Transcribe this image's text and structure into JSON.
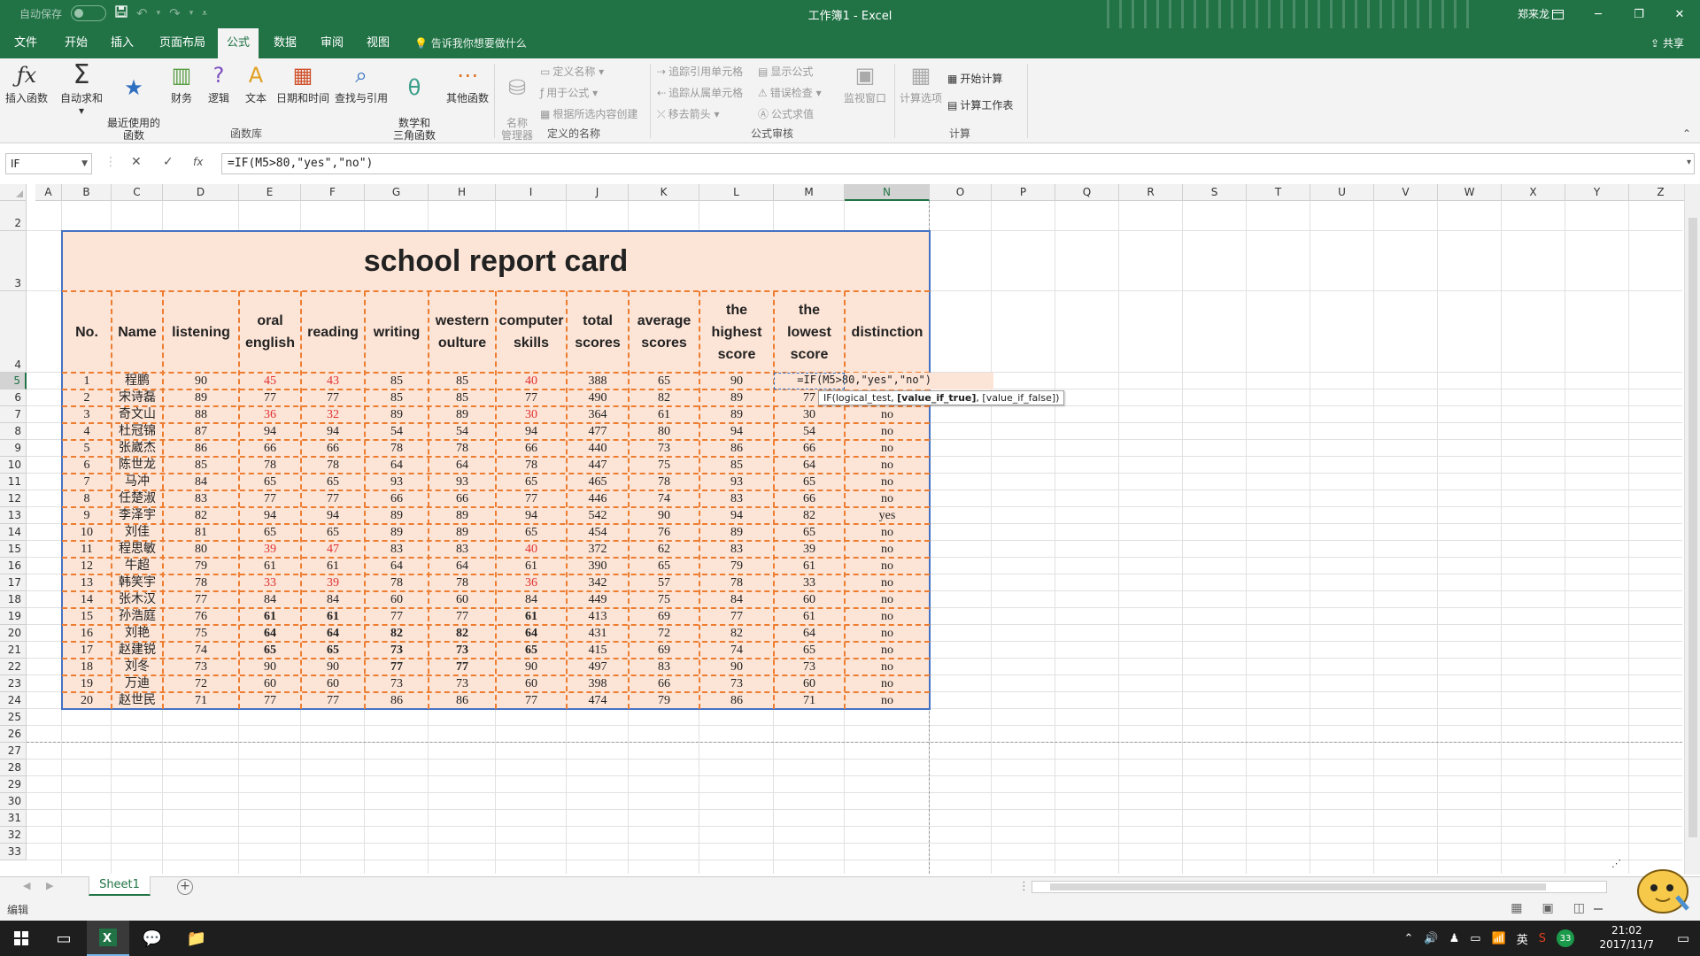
{
  "titlebar": {
    "autosave_label": "自动保存",
    "save_icon": "save-icon",
    "undo_icon": "undo-icon",
    "redo_icon": "redo-icon",
    "doc_title": "工作簿1  -  Excel",
    "user_name": "郑来龙",
    "restore_icon": "ribbon-display-icon",
    "minimize": "─",
    "maximize": "❐",
    "close": "✕"
  },
  "menu": {
    "tabs": [
      "文件",
      "开始",
      "插入",
      "页面布局",
      "公式",
      "数据",
      "审阅",
      "视图"
    ],
    "active_tab": "公式",
    "tell_me": "告诉我你想要做什么",
    "share": "共享"
  },
  "ribbon": {
    "function_library": {
      "label": "函数库",
      "buttons": [
        "插入函数",
        "自动求和",
        "最近使用的\n函数",
        "财务",
        "逻辑",
        "文本",
        "日期和时间",
        "查找与引用",
        "数学和\n三角函数",
        "其他函数"
      ]
    },
    "defined_names": {
      "label": "定义的名称",
      "name_manager": "名称\n管理器",
      "define_name": "定义名称",
      "use_in_formula": "用于公式",
      "create_from_selection": "根据所选内容创建"
    },
    "formula_auditing": {
      "label": "公式审核",
      "trace_precedents": "追踪引用单元格",
      "trace_dependents": "追踪从属单元格",
      "remove_arrows": "移去箭头",
      "show_formulas": "显示公式",
      "error_checking": "错误检查",
      "evaluate_formula": "公式求值",
      "watch_window": "监视窗口"
    },
    "calculation": {
      "label": "计算",
      "calc_options": "计算选项",
      "calc_now": "开始计算",
      "calc_sheet": "计算工作表"
    }
  },
  "formula_bar": {
    "name_box": "IF",
    "cancel": "✕",
    "enter": "✓",
    "fx": "fx",
    "formula": "=IF(M5>80,\"yes\",\"no\")"
  },
  "grid": {
    "columns": [
      "A",
      "B",
      "C",
      "D",
      "E",
      "F",
      "G",
      "H",
      "I",
      "J",
      "K",
      "L",
      "M",
      "N",
      "O",
      "P",
      "Q",
      "R",
      "S",
      "T",
      "U",
      "V",
      "W",
      "X",
      "Y",
      "Z"
    ],
    "selected_column": "N",
    "rows": [
      "2",
      "3",
      "4",
      "5",
      "6",
      "7",
      "8",
      "9",
      "10",
      "11",
      "12",
      "13",
      "14",
      "15",
      "16",
      "17",
      "18",
      "19",
      "20",
      "21",
      "22",
      "23",
      "24",
      "25",
      "26",
      "27",
      "28",
      "29",
      "30",
      "31",
      "32",
      "33"
    ],
    "selected_row": "5"
  },
  "report": {
    "title": "school report card",
    "headers": [
      "No.",
      "Name",
      "listening",
      "oral\nenglish",
      "reading",
      "writing",
      "western\noulture",
      "computer\nskills",
      "total\nscores",
      "average\nscores",
      "the\nhighest\nscore",
      "the\nlowest\nscore",
      "distinction"
    ],
    "rows": [
      {
        "no": "1",
        "name": "程鹏",
        "listening": "90",
        "oral": "45",
        "reading": "43",
        "writing": "85",
        "western": "85",
        "computer": "40",
        "total": "388",
        "average": "65",
        "highest": "90",
        "lowest": "",
        "distinction": "",
        "red": [
          3,
          4,
          7
        ],
        "bold": []
      },
      {
        "no": "2",
        "name": "宋诗磊",
        "listening": "89",
        "oral": "77",
        "reading": "77",
        "writing": "85",
        "western": "85",
        "computer": "77",
        "total": "490",
        "average": "82",
        "highest": "89",
        "lowest": "77",
        "distinction": "",
        "red": [],
        "bold": []
      },
      {
        "no": "3",
        "name": "奇文山",
        "listening": "88",
        "oral": "36",
        "reading": "32",
        "writing": "89",
        "western": "89",
        "computer": "30",
        "total": "364",
        "average": "61",
        "highest": "89",
        "lowest": "30",
        "distinction": "no",
        "red": [
          3,
          4,
          7
        ],
        "bold": []
      },
      {
        "no": "4",
        "name": "杜冠锦",
        "listening": "87",
        "oral": "94",
        "reading": "94",
        "writing": "54",
        "western": "54",
        "computer": "94",
        "total": "477",
        "average": "80",
        "highest": "94",
        "lowest": "54",
        "distinction": "no",
        "red": [],
        "bold": []
      },
      {
        "no": "5",
        "name": "张崴杰",
        "listening": "86",
        "oral": "66",
        "reading": "66",
        "writing": "78",
        "western": "78",
        "computer": "66",
        "total": "440",
        "average": "73",
        "highest": "86",
        "lowest": "66",
        "distinction": "no",
        "red": [],
        "bold": []
      },
      {
        "no": "6",
        "name": "陈世龙",
        "listening": "85",
        "oral": "78",
        "reading": "78",
        "writing": "64",
        "western": "64",
        "computer": "78",
        "total": "447",
        "average": "75",
        "highest": "85",
        "lowest": "64",
        "distinction": "no",
        "red": [],
        "bold": []
      },
      {
        "no": "7",
        "name": "马冲",
        "listening": "84",
        "oral": "65",
        "reading": "65",
        "writing": "93",
        "western": "93",
        "computer": "65",
        "total": "465",
        "average": "78",
        "highest": "93",
        "lowest": "65",
        "distinction": "no",
        "red": [],
        "bold": []
      },
      {
        "no": "8",
        "name": "任楚淑",
        "listening": "83",
        "oral": "77",
        "reading": "77",
        "writing": "66",
        "western": "66",
        "computer": "77",
        "total": "446",
        "average": "74",
        "highest": "83",
        "lowest": "66",
        "distinction": "no",
        "red": [],
        "bold": []
      },
      {
        "no": "9",
        "name": "李泽宇",
        "listening": "82",
        "oral": "94",
        "reading": "94",
        "writing": "89",
        "western": "89",
        "computer": "94",
        "total": "542",
        "average": "90",
        "highest": "94",
        "lowest": "82",
        "distinction": "yes",
        "red": [],
        "bold": []
      },
      {
        "no": "10",
        "name": "刘佳",
        "listening": "81",
        "oral": "65",
        "reading": "65",
        "writing": "89",
        "western": "89",
        "computer": "65",
        "total": "454",
        "average": "76",
        "highest": "89",
        "lowest": "65",
        "distinction": "no",
        "red": [],
        "bold": []
      },
      {
        "no": "11",
        "name": "程思敏",
        "listening": "80",
        "oral": "39",
        "reading": "47",
        "writing": "83",
        "western": "83",
        "computer": "40",
        "total": "372",
        "average": "62",
        "highest": "83",
        "lowest": "39",
        "distinction": "no",
        "red": [
          3,
          4,
          7
        ],
        "bold": []
      },
      {
        "no": "12",
        "name": "牛超",
        "listening": "79",
        "oral": "61",
        "reading": "61",
        "writing": "64",
        "western": "64",
        "computer": "61",
        "total": "390",
        "average": "65",
        "highest": "79",
        "lowest": "61",
        "distinction": "no",
        "red": [],
        "bold": []
      },
      {
        "no": "13",
        "name": "韩笑宇",
        "listening": "78",
        "oral": "33",
        "reading": "39",
        "writing": "78",
        "western": "78",
        "computer": "36",
        "total": "342",
        "average": "57",
        "highest": "78",
        "lowest": "33",
        "distinction": "no",
        "red": [
          3,
          4,
          7
        ],
        "bold": []
      },
      {
        "no": "14",
        "name": "张木汉",
        "listening": "77",
        "oral": "84",
        "reading": "84",
        "writing": "60",
        "western": "60",
        "computer": "84",
        "total": "449",
        "average": "75",
        "highest": "84",
        "lowest": "60",
        "distinction": "no",
        "red": [],
        "bold": []
      },
      {
        "no": "15",
        "name": "孙浩庭",
        "listening": "76",
        "oral": "61",
        "reading": "61",
        "writing": "77",
        "western": "77",
        "computer": "61",
        "total": "413",
        "average": "69",
        "highest": "77",
        "lowest": "61",
        "distinction": "no",
        "red": [],
        "bold": [
          3,
          4,
          7
        ]
      },
      {
        "no": "16",
        "name": "刘艳",
        "listening": "75",
        "oral": "64",
        "reading": "64",
        "writing": "82",
        "western": "82",
        "computer": "64",
        "total": "431",
        "average": "72",
        "highest": "82",
        "lowest": "64",
        "distinction": "no",
        "red": [],
        "bold": [
          3,
          4,
          5,
          6,
          7
        ]
      },
      {
        "no": "17",
        "name": "赵建锐",
        "listening": "74",
        "oral": "65",
        "reading": "65",
        "writing": "73",
        "western": "73",
        "computer": "65",
        "total": "415",
        "average": "69",
        "highest": "74",
        "lowest": "65",
        "distinction": "no",
        "red": [],
        "bold": [
          3,
          4,
          5,
          6,
          7
        ]
      },
      {
        "no": "18",
        "name": "刘冬",
        "listening": "73",
        "oral": "90",
        "reading": "90",
        "writing": "77",
        "western": "77",
        "computer": "90",
        "total": "497",
        "average": "83",
        "highest": "90",
        "lowest": "73",
        "distinction": "no",
        "red": [],
        "bold": [
          5,
          6
        ]
      },
      {
        "no": "19",
        "name": "万迪",
        "listening": "72",
        "oral": "60",
        "reading": "60",
        "writing": "73",
        "western": "73",
        "computer": "60",
        "total": "398",
        "average": "66",
        "highest": "73",
        "lowest": "60",
        "distinction": "no",
        "red": [],
        "bold": []
      },
      {
        "no": "20",
        "name": "赵世民",
        "listening": "71",
        "oral": "77",
        "reading": "77",
        "writing": "86",
        "western": "86",
        "computer": "77",
        "total": "474",
        "average": "79",
        "highest": "86",
        "lowest": "71",
        "distinction": "no",
        "red": [],
        "bold": []
      }
    ],
    "editing_text": "=IF(M5>80,\"yes\",\"no\")",
    "tooltip_parts": [
      "IF(logical_test, ",
      "[value_if_true]",
      ", [value_if_false])"
    ]
  },
  "sheets": {
    "active": "Sheet1",
    "add": "+"
  },
  "status": {
    "mode": "编辑"
  },
  "taskbar": {
    "start_icon": "windows-icon",
    "time": "21:02",
    "date": "2017/11/7",
    "ime": "英",
    "badge": "33"
  },
  "colors": {
    "excel_green": "#217346",
    "card_fill": "#fce4d6",
    "card_border": "#4472c4",
    "dash": "#ed7d31",
    "fail_red": "#e03030"
  }
}
